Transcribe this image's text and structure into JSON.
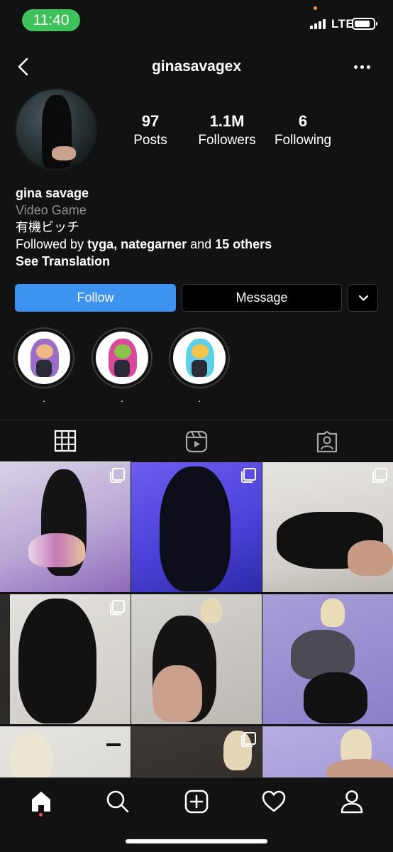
{
  "status_bar": {
    "time": "11:40",
    "network": "LTE"
  },
  "header": {
    "username": "ginasavagex"
  },
  "stats": {
    "posts": {
      "value": "97",
      "label": "Posts"
    },
    "followers": {
      "value": "1.1M",
      "label": "Followers"
    },
    "following": {
      "value": "6",
      "label": "Following"
    }
  },
  "bio": {
    "name": "gina savage",
    "category": "Video Game",
    "text": "有機ビッチ",
    "followed_by_prefix": "Followed by ",
    "followed_by_users": "tyga, nategarner",
    "followed_by_and": " and ",
    "followed_by_others": "15 others",
    "see_translation": "See Translation"
  },
  "actions": {
    "follow_label": "Follow",
    "message_label": "Message"
  },
  "highlights": [
    {
      "label": ".",
      "hair_color": "#9b6ec6"
    },
    {
      "label": ".",
      "hair_color": "#d9489a"
    },
    {
      "label": ".",
      "hair_color": "#5fd0e8"
    }
  ],
  "tabs": [
    "grid-icon",
    "reels-icon",
    "tagged-icon"
  ],
  "colors": {
    "accent": "#3d93f0",
    "background": "#121212",
    "status_pill": "#3ec25a",
    "notification_dot": "#ed4956"
  },
  "bottom_nav": [
    "home-icon",
    "search-icon",
    "new-post-icon",
    "activity-icon",
    "profile-icon"
  ]
}
